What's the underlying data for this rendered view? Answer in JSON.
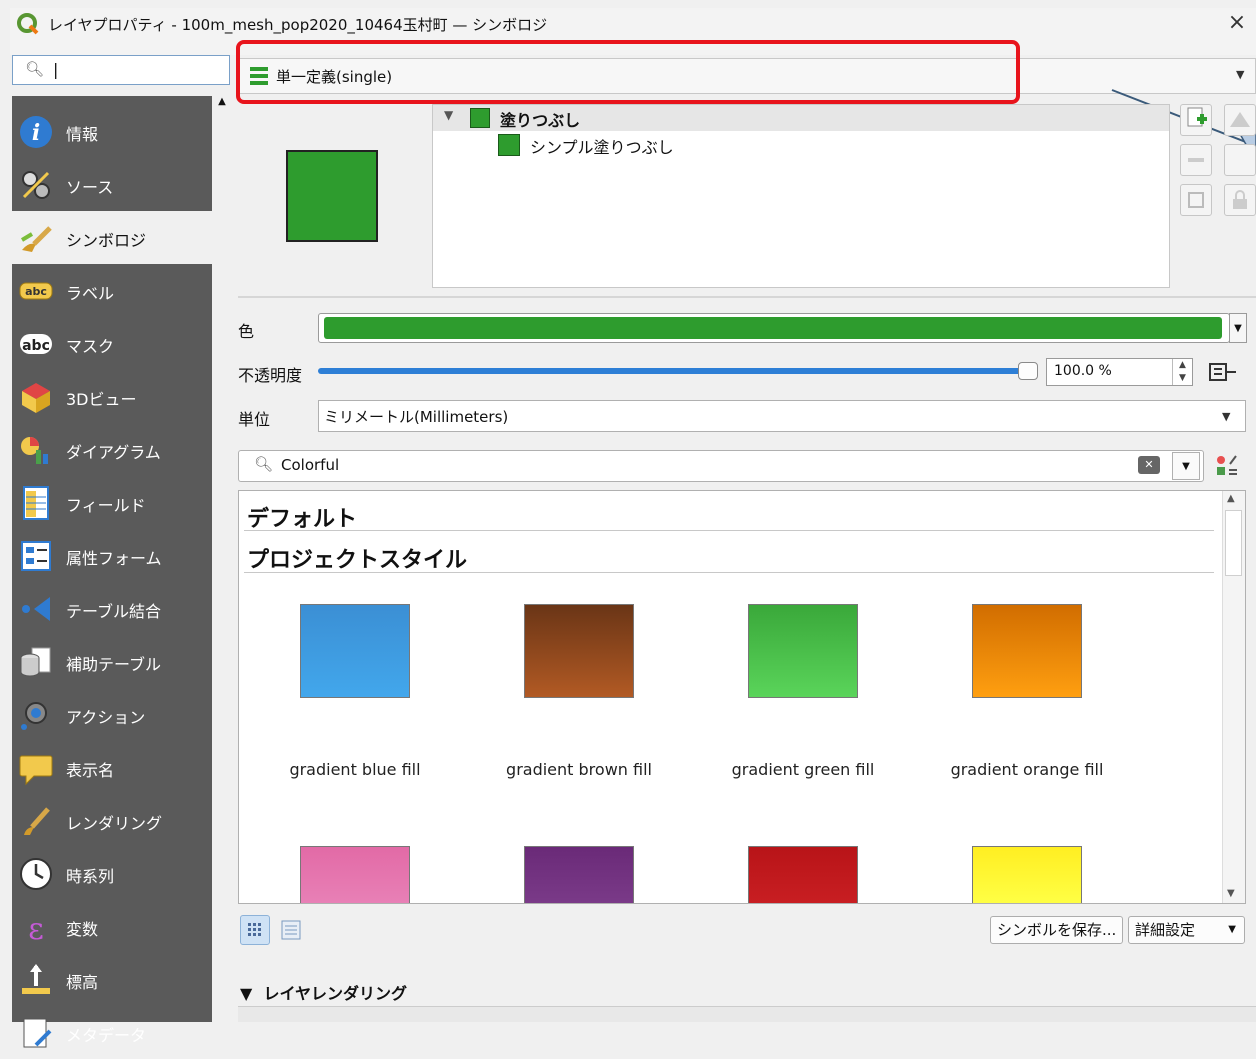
{
  "window": {
    "title": "レイヤプロパティ - 100m_mesh_pop2020_10464玉村町 — シンボロジ",
    "close": "×"
  },
  "sidebar": {
    "search_value": "|",
    "items": [
      {
        "label": "情報",
        "icon": "info-icon"
      },
      {
        "label": "ソース",
        "icon": "source-icon"
      },
      {
        "label": "シンボロジ",
        "icon": "symbology-icon",
        "selected": true
      },
      {
        "label": "ラベル",
        "icon": "labels-icon"
      },
      {
        "label": "マスク",
        "icon": "mask-icon"
      },
      {
        "label": "3Dビュー",
        "icon": "3d-view-icon"
      },
      {
        "label": "ダイアグラム",
        "icon": "diagram-icon"
      },
      {
        "label": "フィールド",
        "icon": "fields-icon"
      },
      {
        "label": "属性フォーム",
        "icon": "attributes-form-icon"
      },
      {
        "label": "テーブル結合",
        "icon": "joins-icon"
      },
      {
        "label": "補助テーブル",
        "icon": "auxiliary-storage-icon"
      },
      {
        "label": "アクション",
        "icon": "actions-icon"
      },
      {
        "label": "表示名",
        "icon": "display-icon"
      },
      {
        "label": "レンダリング",
        "icon": "rendering-icon"
      },
      {
        "label": "時系列",
        "icon": "temporal-icon"
      },
      {
        "label": "変数",
        "icon": "variables-icon"
      },
      {
        "label": "標高",
        "icon": "elevation-icon"
      },
      {
        "label": "メタデータ",
        "icon": "metadata-icon"
      }
    ]
  },
  "renderer": {
    "selected": "単一定義(single)"
  },
  "symbol_tree": {
    "root": "塗りつぶし",
    "child": "シンプル塗りつぶし",
    "fill_color": "#2e9c2e"
  },
  "props": {
    "color_label": "色",
    "color_value": "#2e9c2e",
    "opacity_label": "不透明度",
    "opacity_value": "100.0 %",
    "opacity_fraction": 1.0,
    "unit_label": "単位",
    "unit_value": "ミリメートル(Millimeters)"
  },
  "library": {
    "search_value": "Colorful",
    "groups": [
      "デフォルト",
      "プロジェクトスタイル"
    ],
    "swatches": [
      {
        "name": "gradient blue fill",
        "top": "#3b8fd4",
        "bottom": "#42a7ec"
      },
      {
        "name": "gradient brown fill",
        "top": "#6a3516",
        "bottom": "#b25a24"
      },
      {
        "name": "gradient green fill",
        "top": "#3aa83a",
        "bottom": "#5ad45a"
      },
      {
        "name": "gradient orange fill",
        "top": "#d16d00",
        "bottom": "#ff9f10"
      },
      {
        "name": "",
        "top": "#e26aa6",
        "bottom": "#e880b6"
      },
      {
        "name": "",
        "top": "#6a2a78",
        "bottom": "#7a3a88"
      },
      {
        "name": "",
        "top": "#b81418",
        "bottom": "#c81e22"
      },
      {
        "name": "",
        "top": "#ffee22",
        "bottom": "#ffff44"
      }
    ],
    "save_button": "シンボルを保存...",
    "advanced_button": "詳細設定"
  },
  "layer_rendering": {
    "heading": "レイヤレンダリング"
  }
}
